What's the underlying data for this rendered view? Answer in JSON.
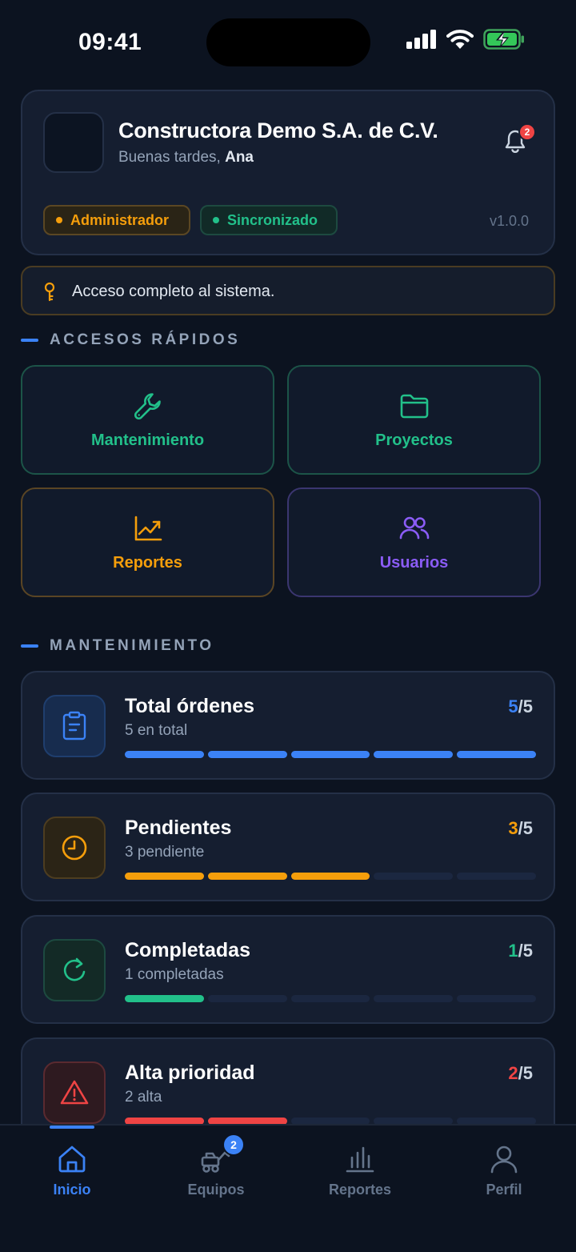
{
  "status_bar": {
    "time": "09:41"
  },
  "header": {
    "company": "Constructora Demo S.A. de C.V.",
    "greeting_prefix": "Buenas tardes, ",
    "user_name": "Ana",
    "notification_count": "2",
    "role_badge": "Administrador",
    "sync_badge": "Sincronizado",
    "version": "v1.0.0"
  },
  "access_banner": {
    "text": "Acceso completo al sistema."
  },
  "quick_access": {
    "title": "ACCESOS RÁPIDOS",
    "tiles": [
      {
        "label": "Mantenimiento",
        "icon": "wrench-icon",
        "color": "#22c08a"
      },
      {
        "label": "Proyectos",
        "icon": "folder-icon",
        "color": "#22c08a"
      },
      {
        "label": "Reportes",
        "icon": "trend-chart-icon",
        "color": "#f59e0b"
      },
      {
        "label": "Usuarios",
        "icon": "users-icon",
        "color": "#8b5cf6"
      }
    ]
  },
  "maintenance": {
    "title": "MANTENIMIENTO",
    "stats": [
      {
        "title": "Total órdenes",
        "subtitle": "5 en total",
        "value": "5",
        "total": "/5",
        "filled": 5,
        "color": "#3b82f6",
        "icon": "clipboard-icon"
      },
      {
        "title": "Pendientes",
        "subtitle": "3 pendiente",
        "value": "3",
        "total": "/5",
        "filled": 3,
        "color": "#f59e0b",
        "icon": "clock-icon"
      },
      {
        "title": "Completadas",
        "subtitle": "1 completadas",
        "value": "1",
        "total": "/5",
        "filled": 1,
        "color": "#22c08a",
        "icon": "refresh-icon"
      },
      {
        "title": "Alta prioridad",
        "subtitle": "2 alta",
        "value": "2",
        "total": "/5",
        "filled": 2,
        "color": "#ef4444",
        "icon": "warning-icon"
      }
    ]
  },
  "bottom_nav": {
    "items": [
      {
        "label": "Inicio",
        "icon": "home-icon",
        "active": true
      },
      {
        "label": "Equipos",
        "icon": "excavator-icon",
        "badge": "2"
      },
      {
        "label": "Reportes",
        "icon": "bar-chart-icon"
      },
      {
        "label": "Perfil",
        "icon": "user-icon"
      }
    ],
    "active_color": "#3b82f6"
  }
}
